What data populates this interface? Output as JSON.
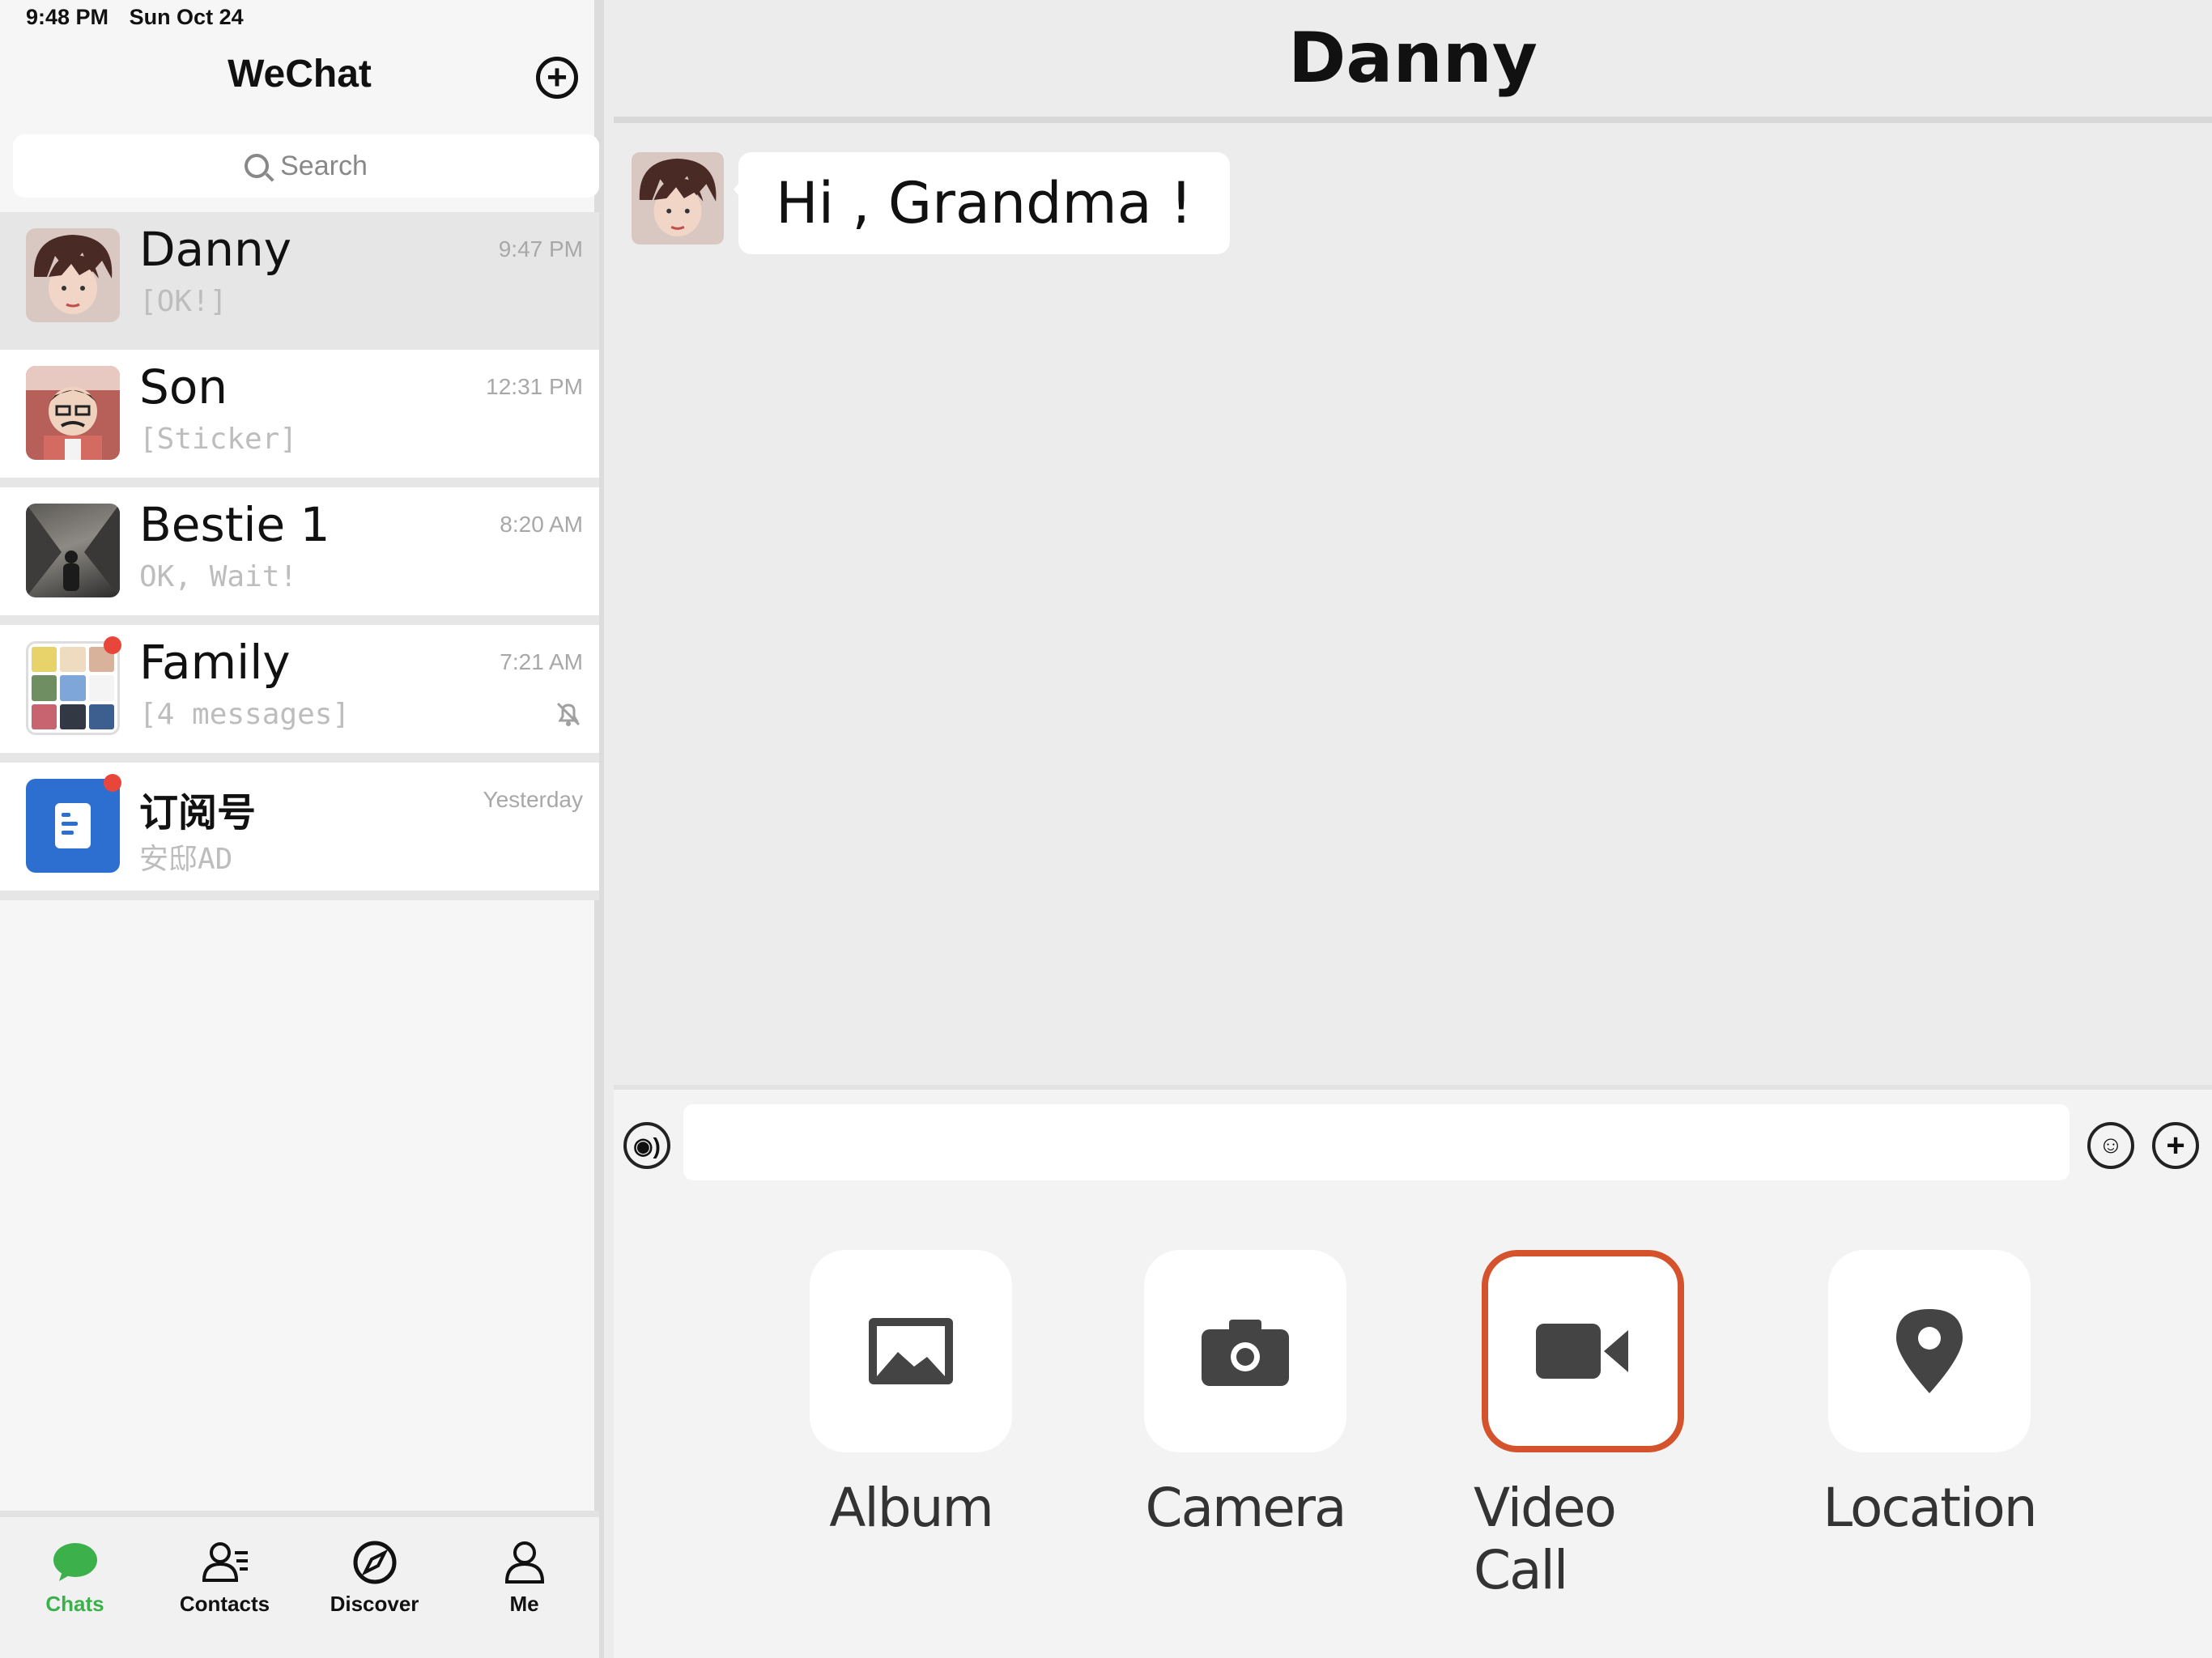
{
  "status_bar": {
    "time": "9:48 PM",
    "date": "Sun Oct 24"
  },
  "sidebar": {
    "title": "WeChat",
    "search_placeholder": "Search",
    "chats": [
      {
        "name": "Danny",
        "preview": "[OK!]",
        "time": "9:47 PM",
        "unread": false,
        "muted": false
      },
      {
        "name": "Son",
        "preview": "[Sticker]",
        "time": "12:31 PM",
        "unread": false,
        "muted": false
      },
      {
        "name": "Bestie 1",
        "preview": "OK, Wait!",
        "time": "8:20 AM",
        "unread": false,
        "muted": false
      },
      {
        "name": "Family",
        "preview": "[4 messages]",
        "time": "7:21 AM",
        "unread": true,
        "muted": true
      },
      {
        "name": "订阅号",
        "preview": "安邸AD",
        "time": "Yesterday",
        "unread": true,
        "muted": false
      }
    ],
    "tabs": [
      {
        "label": "Chats",
        "icon": "chat-bubble-icon",
        "active": true
      },
      {
        "label": "Contacts",
        "icon": "contacts-icon",
        "active": false
      },
      {
        "label": "Discover",
        "icon": "compass-icon",
        "active": false
      },
      {
        "label": "Me",
        "icon": "person-icon",
        "active": false
      }
    ]
  },
  "conversation": {
    "title": "Danny",
    "messages": [
      {
        "sender": "Danny",
        "text": "Hi , Grandma !"
      }
    ],
    "input_value": "",
    "actions": [
      {
        "label": "Album",
        "icon": "image-icon",
        "highlighted": false
      },
      {
        "label": "Camera",
        "icon": "camera-icon",
        "highlighted": false
      },
      {
        "label": "Video Call",
        "icon": "video-camera-icon",
        "highlighted": true
      },
      {
        "label": "Location",
        "icon": "location-pin-icon",
        "highlighted": false
      }
    ]
  },
  "colors": {
    "accent_green": "#3cb04a",
    "unread_red": "#e8463a",
    "highlight_orange": "#d4532c",
    "subscription_blue": "#2d6fd0"
  }
}
